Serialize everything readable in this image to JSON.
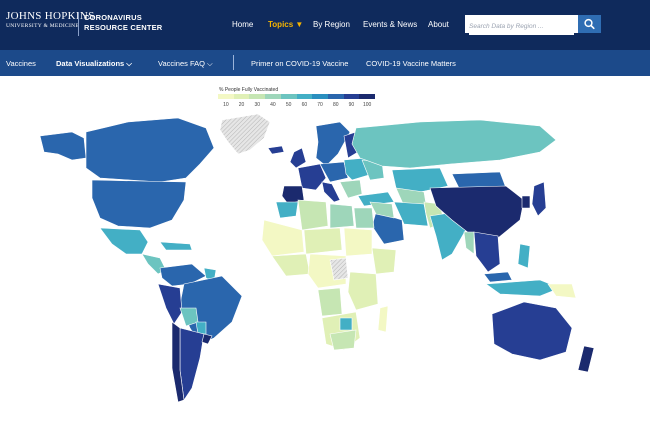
{
  "header": {
    "logo_line1": "JOHNS HOPKINS",
    "logo_line2": "UNIVERSITY & MEDICINE",
    "center_line1": "CORONAVIRUS",
    "center_line2": "RESOURCE CENTER",
    "nav": [
      {
        "label": "Home"
      },
      {
        "label": "Topics ▼"
      },
      {
        "label": "By Region"
      },
      {
        "label": "Events & News"
      },
      {
        "label": "About"
      }
    ],
    "search_placeholder": "Search Data by Region ..."
  },
  "subnav": {
    "items": [
      {
        "label": "Vaccines"
      },
      {
        "label": "Data Visualizations ⌵"
      },
      {
        "label": "Vaccines FAQ ⌵"
      },
      {
        "label": "Primer on COVID-19 Vaccine"
      },
      {
        "label": "COVID-19 Vaccine Matters"
      }
    ]
  },
  "legend": {
    "title": "% People Fully Vaccinated",
    "ticks": [
      "10",
      "20",
      "30",
      "40",
      "50",
      "60",
      "70",
      "80",
      "90",
      "100"
    ],
    "colors": [
      "#f3f8c4",
      "#e0f0b6",
      "#c6e6b3",
      "#9ed6ba",
      "#6cc4c0",
      "#43afc5",
      "#2a8fbf",
      "#2a66ad",
      "#263e93",
      "#1b2a6e"
    ]
  },
  "colors": {
    "topbar": "#0f2a5c",
    "subnav": "#1c4a8a",
    "topics_accent": "#f5b400",
    "search_button": "#2f6db3",
    "no_data_hatch": "#d8d8d8"
  }
}
